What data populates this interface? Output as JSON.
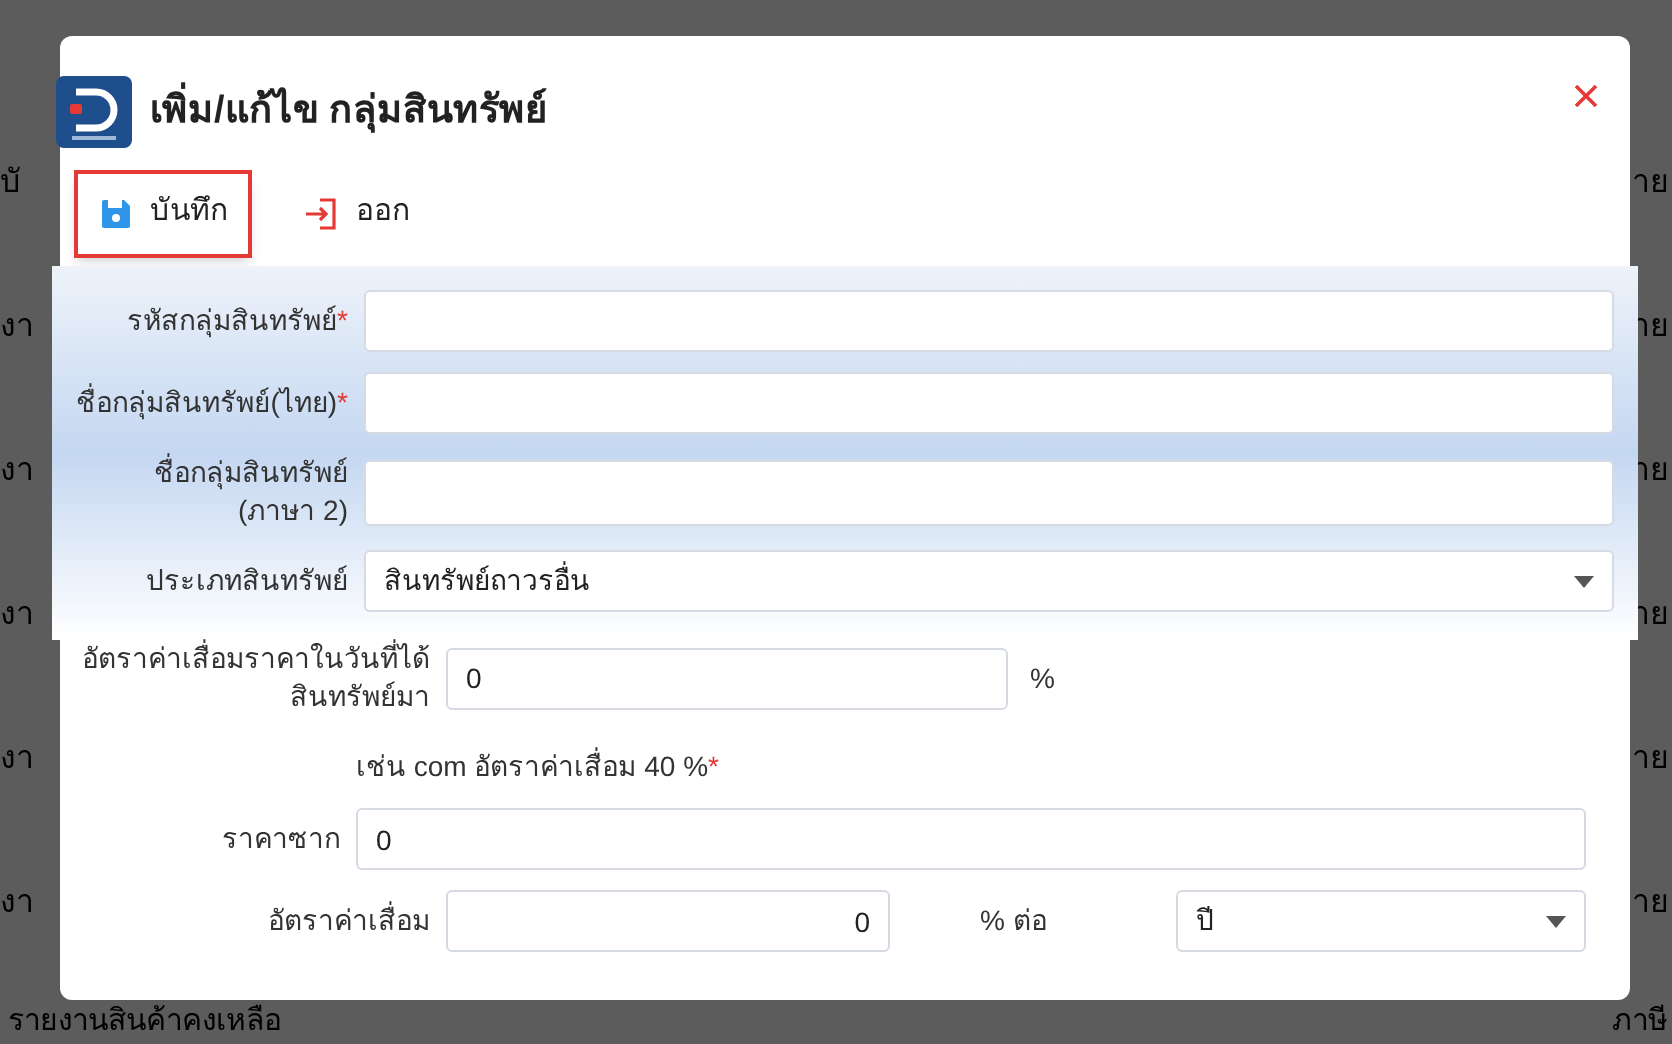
{
  "background": {
    "left_items": [
      "บั",
      "งา",
      "งา",
      "งา",
      "งา",
      "งา"
    ],
    "right_items": [
      "าย",
      "าย",
      "าย",
      "าย",
      "าย",
      "าย"
    ],
    "bottom_item": "รายงานสินค้าคงเหลือ",
    "bottom_right_item": "ภาษี"
  },
  "dialog": {
    "title": "เพิ่ม/แก้ไข กลุ่มสินทรัพย์"
  },
  "toolbar": [
    {
      "kind": "save",
      "label": "บันทึก",
      "highlighted": true
    },
    {
      "kind": "exit",
      "label": "ออก",
      "highlighted": false
    }
  ],
  "fields": [
    {
      "kind": "text",
      "label": "รหัสกลุ่มสินทรัพย์",
      "required_mark": "*"
    },
    {
      "kind": "text",
      "label": "ชื่อกลุ่มสินทรัพย์(ไทย)",
      "required_mark": "*"
    },
    {
      "kind": "text",
      "label": "ชื่อกลุ่มสินทรัพย์",
      "label_2": "(ภาษา 2)"
    },
    {
      "kind": "select",
      "label": "ประเภทสินทรัพย์",
      "value": "สินทรัพย์ถาวรอื่น"
    }
  ],
  "rate_on_acquire": {
    "label": "อัตราค่าเสื่อมราคาในวันที่ได้",
    "label_2": "สินทรัพย์มา",
    "value": "0",
    "unit": "%"
  },
  "hint": {
    "text": "เช่น com อัตราค่าเสื่อม 40 %",
    "required_mark": "*"
  },
  "salvage": {
    "label": "ราคาซาก",
    "value": "0"
  },
  "depreciation": {
    "label": "อัตราค่าเสื่อม",
    "value": "0",
    "unit": "% ต่อ",
    "period": "ปี"
  }
}
